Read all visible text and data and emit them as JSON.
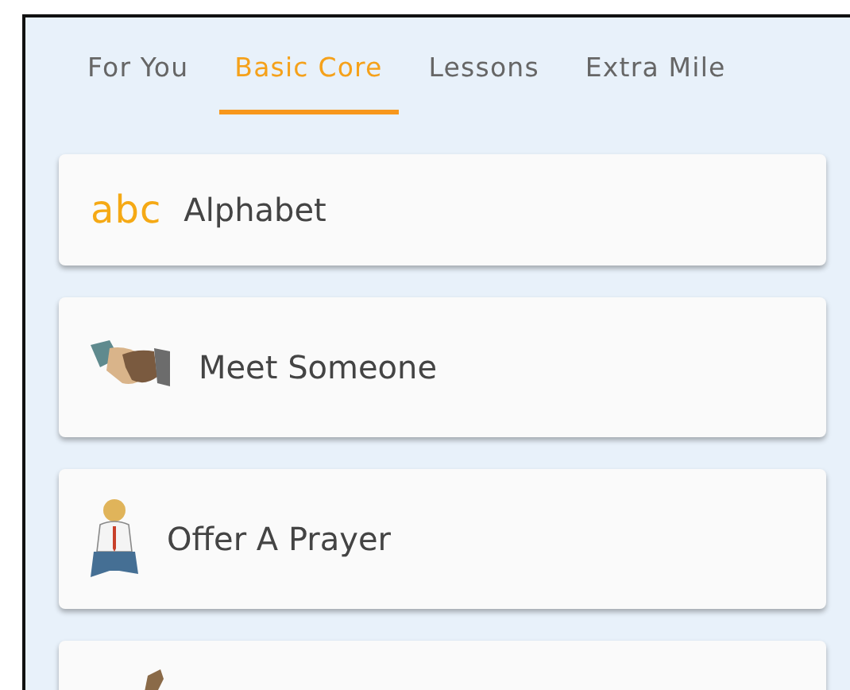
{
  "tabs": [
    {
      "label": "For You",
      "selected": false
    },
    {
      "label": "Basic Core",
      "selected": true
    },
    {
      "label": "Lessons",
      "selected": false
    },
    {
      "label": "Extra Mile",
      "selected": false
    }
  ],
  "lessons": [
    {
      "kind": "letters",
      "icon_text": "abc",
      "label": "Alphabet"
    },
    {
      "kind": "handshake",
      "label": "Meet Someone"
    },
    {
      "kind": "prayer",
      "label": "Offer A Prayer"
    },
    {
      "kind": "figure"
    }
  ]
}
